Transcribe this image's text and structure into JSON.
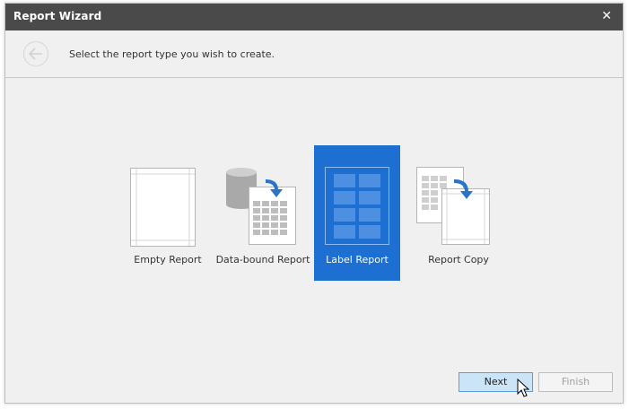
{
  "window": {
    "title": "Report Wizard",
    "close_glyph": "✕"
  },
  "header": {
    "back_icon": "back-arrow-icon",
    "instruction": "Select the report type you wish to create."
  },
  "report_types": [
    {
      "label": "Empty Report",
      "icon": "empty-report-icon",
      "selected": false
    },
    {
      "label": "Data-bound Report",
      "icon": "data-bound-report-icon",
      "selected": false
    },
    {
      "label": "Label Report",
      "icon": "label-report-icon",
      "selected": true
    },
    {
      "label": "Report Copy",
      "icon": "report-copy-icon",
      "selected": false
    }
  ],
  "buttons": {
    "next": "Next",
    "finish": "Finish"
  },
  "colors": {
    "selected_bg": "#1e6fd2",
    "title_bar": "#4a4a4a",
    "accent_arrow": "#2b73c6"
  }
}
